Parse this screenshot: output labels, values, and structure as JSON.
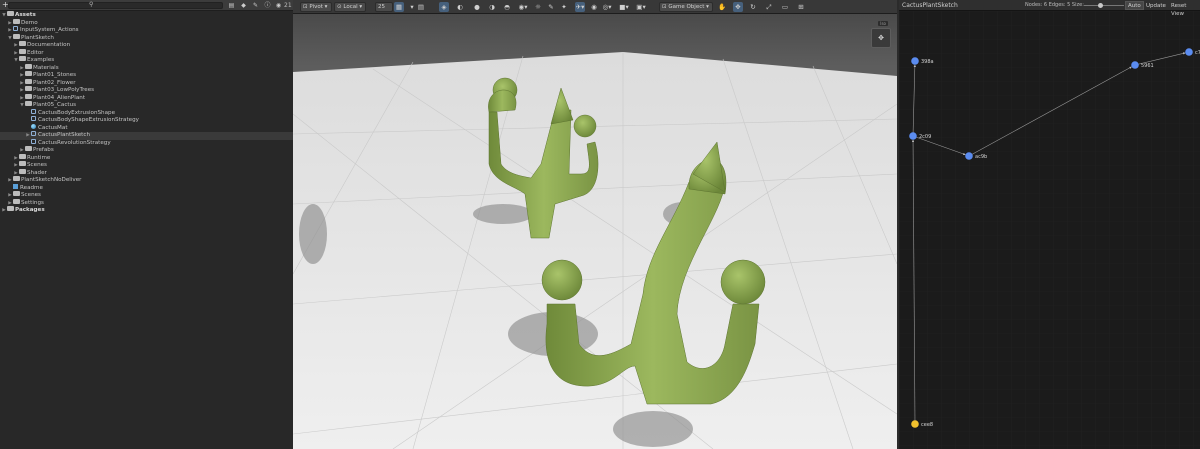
{
  "project": {
    "search_placeholder": "",
    "icon_count": "21",
    "tree": [
      {
        "label": "Assets",
        "depth": 0,
        "arrow": "▼",
        "icon": "folder",
        "bold": true
      },
      {
        "label": "Demo",
        "depth": 1,
        "arrow": "▶",
        "icon": "folder"
      },
      {
        "label": "InputSystem_Actions",
        "depth": 1,
        "arrow": "▶",
        "icon": "file"
      },
      {
        "label": "PlantSketch",
        "depth": 1,
        "arrow": "▼",
        "icon": "folder"
      },
      {
        "label": "Documentation",
        "depth": 2,
        "arrow": "▶",
        "icon": "folder"
      },
      {
        "label": "Editor",
        "depth": 2,
        "arrow": "▶",
        "icon": "folder"
      },
      {
        "label": "Examples",
        "depth": 2,
        "arrow": "▼",
        "icon": "folder"
      },
      {
        "label": "Materials",
        "depth": 3,
        "arrow": "▶",
        "icon": "folder"
      },
      {
        "label": "Plant01_Stones",
        "depth": 3,
        "arrow": "▶",
        "icon": "folder"
      },
      {
        "label": "Plant02_Flower",
        "depth": 3,
        "arrow": "▶",
        "icon": "folder"
      },
      {
        "label": "Plant03_LowPolyTrees",
        "depth": 3,
        "arrow": "▶",
        "icon": "folder"
      },
      {
        "label": "Plant04_AlienPlant",
        "depth": 3,
        "arrow": "▶",
        "icon": "folder"
      },
      {
        "label": "Plant05_Cactus",
        "depth": 3,
        "arrow": "▼",
        "icon": "folder"
      },
      {
        "label": "CactusBodyExtrusionShape",
        "depth": 4,
        "arrow": "",
        "icon": "file"
      },
      {
        "label": "CactusBodyShapeExtrusionStrategy",
        "depth": 4,
        "arrow": "",
        "icon": "file"
      },
      {
        "label": "CactusMat",
        "depth": 4,
        "arrow": "",
        "icon": "mat"
      },
      {
        "label": "CactusPlantSketch",
        "depth": 4,
        "arrow": "▶",
        "icon": "file",
        "selected": true
      },
      {
        "label": "CactusRevolutionStrategy",
        "depth": 4,
        "arrow": "",
        "icon": "file"
      },
      {
        "label": "Prefabs",
        "depth": 3,
        "arrow": "▶",
        "icon": "folder"
      },
      {
        "label": "Runtime",
        "depth": 2,
        "arrow": "▶",
        "icon": "folder"
      },
      {
        "label": "Scenes",
        "depth": 2,
        "arrow": "▶",
        "icon": "folder"
      },
      {
        "label": "Shader",
        "depth": 2,
        "arrow": "▶",
        "icon": "folder"
      },
      {
        "label": "PlantSketchNoDeliver",
        "depth": 1,
        "arrow": "▶",
        "icon": "folder"
      },
      {
        "label": "Readme",
        "depth": 1,
        "arrow": "",
        "icon": "prefab"
      },
      {
        "label": "Scenes",
        "depth": 1,
        "arrow": "▶",
        "icon": "folder"
      },
      {
        "label": "Settings",
        "depth": 1,
        "arrow": "▶",
        "icon": "folder"
      },
      {
        "label": "Packages",
        "depth": 0,
        "arrow": "▶",
        "icon": "folder",
        "bold": true
      }
    ]
  },
  "scene": {
    "pivot_label": "Pivot",
    "space_label": "Local",
    "snap_value": "25",
    "context_label": "Game Object",
    "orientation_label": "Iso"
  },
  "graph": {
    "title": "CactusPlantSketch",
    "stats": "Nodes: 6  Edges: 5  Size:",
    "size_fraction": 0.4,
    "auto_label": "Auto",
    "update_label": "Update",
    "reset_label": "Reset View",
    "nodes": [
      {
        "id": "398a",
        "color": "#5b8cf0"
      },
      {
        "id": "2c09",
        "color": "#5b8cf0"
      },
      {
        "id": "ac9b",
        "color": "#5b8cf0"
      },
      {
        "id": "5961",
        "color": "#5b8cf0"
      },
      {
        "id": "c7",
        "color": "#5b8cf0"
      },
      {
        "id": "cee8",
        "color": "#f2c12e"
      }
    ]
  },
  "colors": {
    "accent_blue": "#46607c",
    "cactus": "#8aa84e",
    "node_root": "#f2c12e",
    "node": "#5b8cf0"
  }
}
